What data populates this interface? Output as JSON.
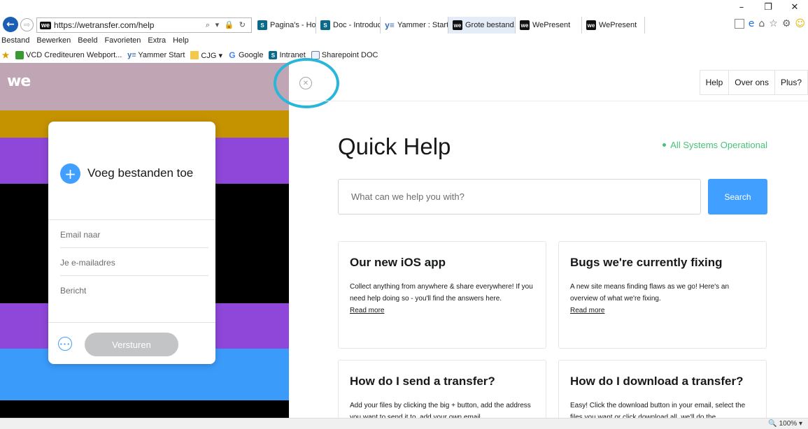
{
  "browser": {
    "window_controls": {
      "minimize": "–",
      "restore": "❐",
      "close": "✕"
    },
    "back_glyph": "←",
    "forward_glyph": "⇨",
    "address_favicon": "we",
    "url": "https://wetransfer.com/help",
    "address_tools": "⌕ ▾ 🔒 ↻",
    "tabs": [
      {
        "icon": "S",
        "kind": "sp",
        "label": "Pagina's - Home..."
      },
      {
        "icon": "S",
        "kind": "sp",
        "label": "Doc - Introductie..."
      },
      {
        "icon": "y≡",
        "kind": "ya",
        "label": "Yammer : Start"
      },
      {
        "icon": "we",
        "kind": "we",
        "label": "Grote bestand...",
        "close": "✕"
      },
      {
        "icon": "we",
        "kind": "we",
        "label": "WePresent"
      },
      {
        "icon": "we",
        "kind": "we",
        "label": "WePresent"
      }
    ],
    "right_tools": {
      "home": "⌂",
      "star": "☆",
      "gear": "⚙",
      "smile": "☺",
      "ie": "e"
    },
    "menu": [
      "Bestand",
      "Bewerken",
      "Beeld",
      "Favorieten",
      "Extra",
      "Help"
    ],
    "favorites": [
      {
        "icon": "★",
        "kind": "star",
        "label": ""
      },
      {
        "icon": "",
        "kind": "leaf",
        "label": "VCD Crediteuren Webport..."
      },
      {
        "icon": "y≡",
        "kind": "ya",
        "label": "Yammer Start"
      },
      {
        "icon": "",
        "kind": "folder",
        "label": "CJG ▾"
      },
      {
        "icon": "G",
        "kind": "g",
        "label": "Google"
      },
      {
        "icon": "S",
        "kind": "sp",
        "label": "Intranet"
      },
      {
        "icon": "",
        "kind": "doc",
        "label": "Sharepoint DOC"
      }
    ],
    "zoom": "🔍 100%  ▾"
  },
  "left": {
    "logo": "we",
    "stripes": [
      {
        "color": "#c0a6b4"
      },
      {
        "color": "#c59300"
      },
      {
        "color": "#8e47d9"
      },
      {
        "color": "#000000"
      },
      {
        "color": "#8e47d9"
      },
      {
        "color": "#3b9bfb"
      },
      {
        "color": "#000000"
      }
    ],
    "upload": {
      "add_glyph": "+",
      "add_label": "Voeg bestanden toe",
      "fields": [
        "Email naar",
        "Je e-mailadres",
        "Bericht"
      ],
      "more_glyph": "···",
      "send_label": "Versturen"
    }
  },
  "help": {
    "close_glyph": "✕",
    "nav": [
      "Help",
      "Over ons",
      "Plus?"
    ],
    "title": "Quick Help",
    "status": "All Systems Operational",
    "search_placeholder": "What can we help you with?",
    "search_button": "Search",
    "cards": [
      {
        "title": "Our new iOS app",
        "body": "Collect anything from anywhere & share everywhere! If you need help doing so - you'll find the answers here.",
        "link": "Read more"
      },
      {
        "title": "Bugs we're currently fixing",
        "body": "A new site means finding flaws as we go! Here's an overview of what we're fixing.",
        "link": "Read more"
      },
      {
        "title": "How do I send a transfer?",
        "body": "Add your files by clicking the big + button, add the address you want to send it to, add your own email",
        "link": ""
      },
      {
        "title": "How do I download a transfer?",
        "body": "Easy! Click the download button in your email, select the files you want or click download all, we'll do the",
        "link": ""
      }
    ]
  }
}
